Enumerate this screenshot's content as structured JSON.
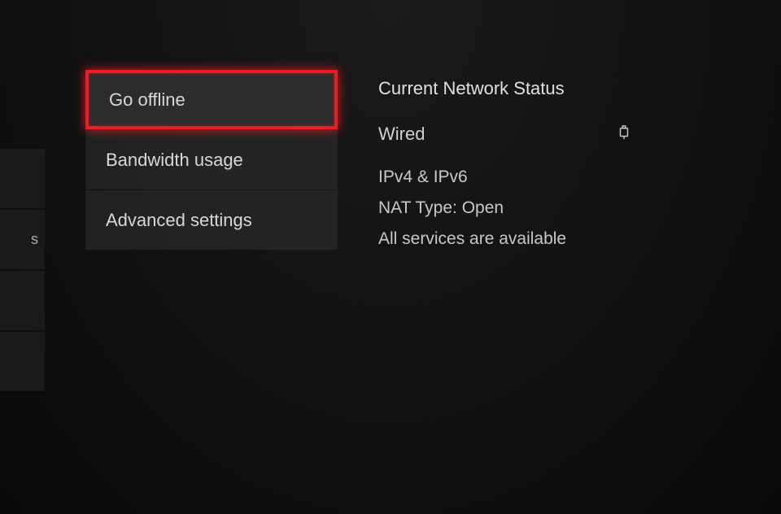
{
  "left_edge": {
    "visible_letter": "s"
  },
  "menu": {
    "items": [
      {
        "label": "Go offline",
        "highlighted": true
      },
      {
        "label": "Bandwidth usage",
        "highlighted": false
      },
      {
        "label": "Advanced settings",
        "highlighted": false
      }
    ]
  },
  "status": {
    "heading": "Current Network Status",
    "connection_type": "Wired",
    "lines": [
      "IPv4 & IPv6",
      "NAT Type: Open",
      "All services are available"
    ]
  }
}
